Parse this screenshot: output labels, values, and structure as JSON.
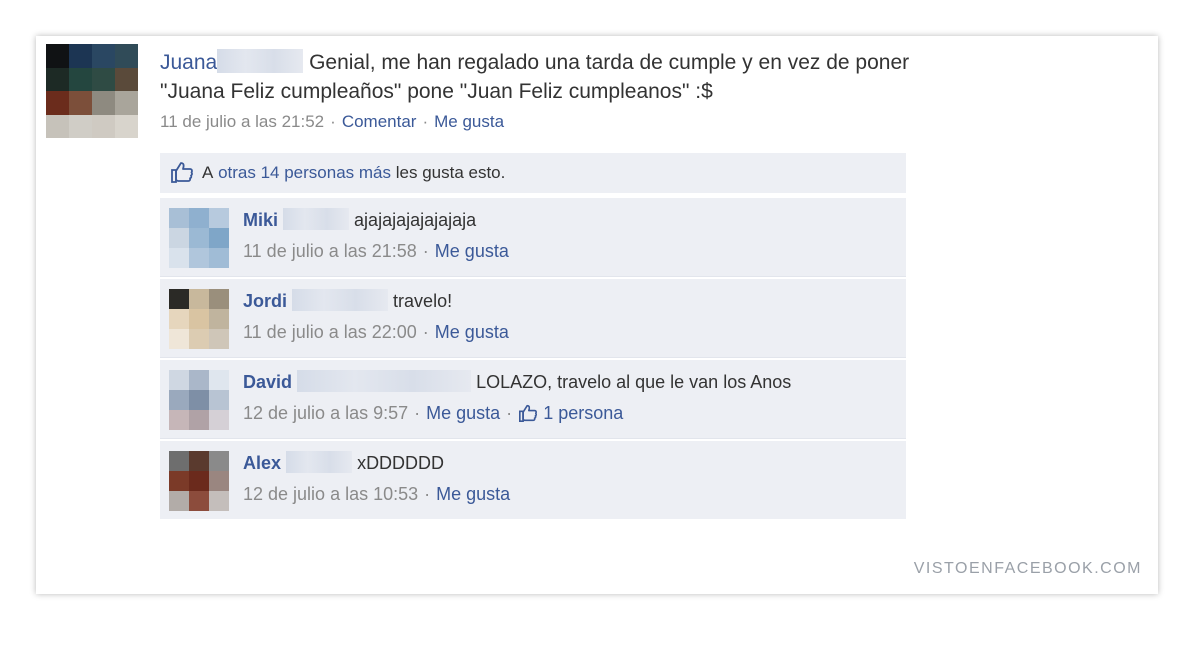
{
  "post": {
    "author": "Juana",
    "text_line1": "Genial, me han regalado una tarda de cumple y en vez de poner",
    "text_line2": "\"Juana Feliz cumpleaños\" pone \"Juan Feliz cumpleanos\" :$",
    "timestamp": "11 de julio a las 21:52",
    "comment_link": "Comentar",
    "like_link": "Me gusta",
    "avatar_colors": [
      "#101214",
      "#1c3553",
      "#2a4762",
      "#304b58",
      "#1d2a25",
      "#24463f",
      "#2f4b44",
      "#5a4a3a",
      "#6b2c1c",
      "#7c4f3a",
      "#8e8a80",
      "#a9a59b",
      "#c6c2ba",
      "#d0cdc6",
      "#cfcac2",
      "#d8d4cc"
    ]
  },
  "likes_bar": {
    "prefix": "A",
    "link": "otras 14 personas más",
    "suffix": "les gusta esto."
  },
  "comments": [
    {
      "name": "Miki",
      "text": "ajajajajajajajaja",
      "timestamp": "11 de julio a las 21:58",
      "like_link": "Me gusta",
      "avatar_colors": [
        "#a8bfd6",
        "#8fb0cf",
        "#b7cade",
        "#cbd6e2",
        "#9bb9d4",
        "#7fa6c8",
        "#d9e2ec",
        "#b0c6dc",
        "#a0bcd6"
      ]
    },
    {
      "name": "Jordi",
      "text": "travelo!",
      "timestamp": "11 de julio a las 22:00",
      "like_link": "Me gusta",
      "avatar_colors": [
        "#2b2a26",
        "#c8b89c",
        "#9a8f7c",
        "#e6d6bd",
        "#d9c4a2",
        "#c0b49e",
        "#efe6d8",
        "#dcccb2",
        "#cfc6b8"
      ]
    },
    {
      "name": "David",
      "text": "LOLAZO, travelo al que le van los Anos",
      "timestamp": "12 de julio a las 9:57",
      "like_link": "Me gusta",
      "liked_count": "1 persona",
      "avatar_colors": [
        "#cfd7e2",
        "#aab7c9",
        "#dfe6ee",
        "#9aa9bd",
        "#7e8fa6",
        "#b8c4d3",
        "#c6b6b8",
        "#b0a2a6",
        "#d5d0d6"
      ]
    },
    {
      "name": "Alex",
      "text": "xDDDDDD",
      "timestamp": "12 de julio a las 10:53",
      "like_link": "Me gusta",
      "avatar_colors": [
        "#6e6e6e",
        "#5a3a2e",
        "#8a8a8a",
        "#7b3a28",
        "#6b2a1c",
        "#9a8680",
        "#b2aca8",
        "#8c4c3c",
        "#c4bebb"
      ]
    }
  ],
  "watermark": "VISTOENFACEBOOK.COM",
  "colors": {
    "link": "#3b5998",
    "meta": "#8a8a8a",
    "comment_bg": "#edeff4"
  }
}
